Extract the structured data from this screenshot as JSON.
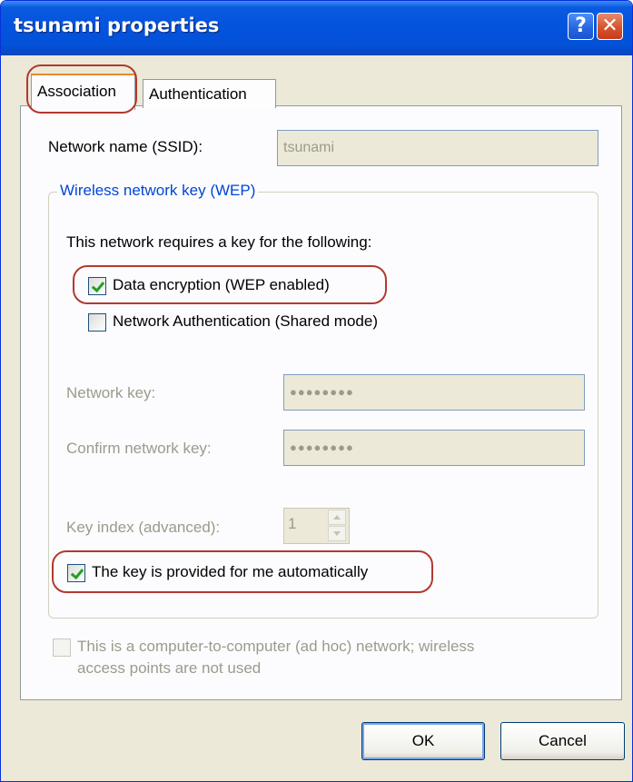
{
  "window": {
    "title": "tsunami properties",
    "help_glyph": "?",
    "close_glyph": "✕"
  },
  "tabs": [
    {
      "label": "Association",
      "active": true
    },
    {
      "label": "Authentication",
      "active": false
    }
  ],
  "ssid": {
    "label": "Network name (SSID):",
    "value": "tsunami"
  },
  "wep_group": {
    "title": "Wireless network key (WEP)",
    "requires_text": "This network requires a key for the following:",
    "data_encryption": {
      "label": "Data encryption (WEP enabled)",
      "checked": true
    },
    "network_auth": {
      "label": "Network Authentication (Shared mode)",
      "checked": false
    },
    "network_key": {
      "label": "Network key:",
      "value": "●●●●●●●●"
    },
    "confirm_key": {
      "label": "Confirm network key:",
      "value": "●●●●●●●●"
    },
    "key_index": {
      "label": "Key index (advanced):",
      "value": "1"
    },
    "auto_key": {
      "label": "The key is provided for me automatically",
      "checked": true
    }
  },
  "adhoc": {
    "line1": "This is a computer-to-computer (ad hoc) network; wireless",
    "line2": "access points are not used",
    "checked": false
  },
  "buttons": {
    "ok": "OK",
    "cancel": "Cancel"
  },
  "colors": {
    "titlebar": "#0453de",
    "annotation": "#b23a2e",
    "group_title": "#0046d5"
  }
}
